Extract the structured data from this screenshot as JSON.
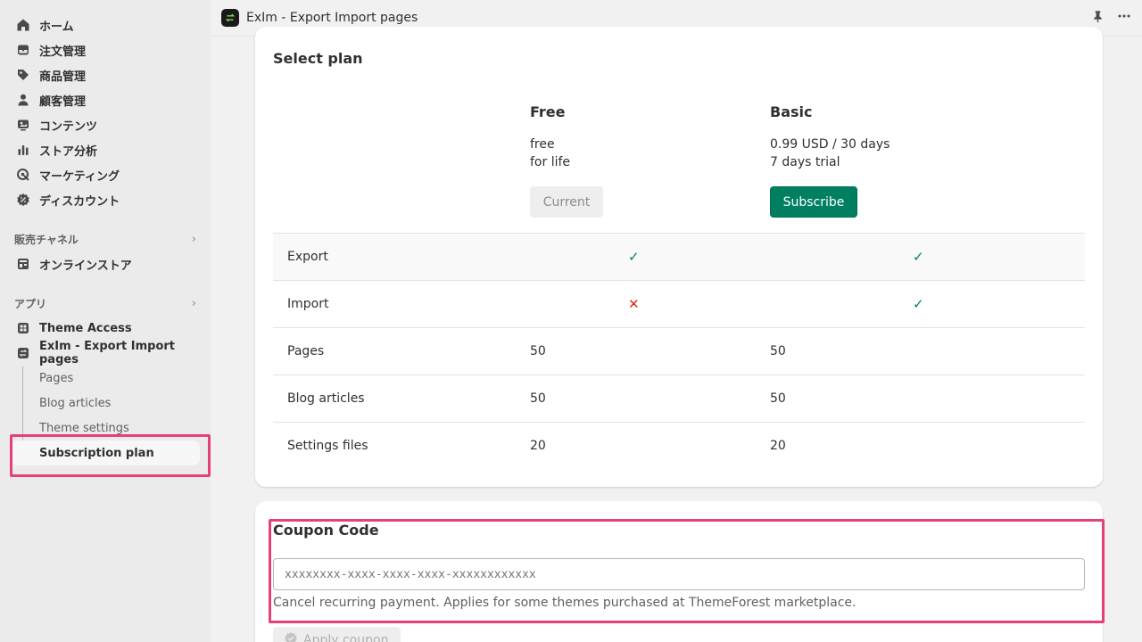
{
  "sidebar": {
    "nav": [
      {
        "label": "ホーム",
        "icon": "home-icon"
      },
      {
        "label": "注文管理",
        "icon": "inbox-icon"
      },
      {
        "label": "商品管理",
        "icon": "tag-icon"
      },
      {
        "label": "顧客管理",
        "icon": "person-icon"
      },
      {
        "label": "コンテンツ",
        "icon": "image-icon"
      },
      {
        "label": "ストア分析",
        "icon": "bar-chart-icon"
      },
      {
        "label": "マーケティング",
        "icon": "target-icon"
      },
      {
        "label": "ディスカウント",
        "icon": "discount-icon"
      }
    ],
    "sales_channels": {
      "title": "販売チャネル",
      "items": [
        {
          "label": "オンラインストア",
          "icon": "store-icon"
        }
      ]
    },
    "apps": {
      "title": "アプリ",
      "items": [
        {
          "label": "Theme Access",
          "icon": "app-icon"
        },
        {
          "label": "ExIm - Export Import pages",
          "icon": "exim-app-icon"
        }
      ],
      "subitems": [
        "Pages",
        "Blog articles",
        "Theme settings",
        "Subscription plan"
      ]
    }
  },
  "topbar": {
    "title": "ExIm - Export Import pages"
  },
  "plan_card": {
    "title": "Select plan",
    "plans": [
      {
        "name": "Free",
        "line1": "free",
        "line2": "for life",
        "button": "Current"
      },
      {
        "name": "Basic",
        "line1": "0.99 USD / 30 days",
        "line2": "7 days trial",
        "button": "Subscribe"
      }
    ],
    "features": [
      {
        "name": "Export",
        "free": "✓",
        "basic": "✓"
      },
      {
        "name": "Import",
        "free": "✕",
        "basic": "✓"
      },
      {
        "name": "Pages",
        "free": "50",
        "basic": "50"
      },
      {
        "name": "Blog articles",
        "free": "50",
        "basic": "50"
      },
      {
        "name": "Settings files",
        "free": "20",
        "basic": "20"
      }
    ]
  },
  "coupon_card": {
    "title": "Coupon Code",
    "placeholder": "xxxxxxxx-xxxx-xxxx-xxxx-xxxxxxxxxxxx",
    "help": "Cancel recurring payment. Applies for some themes purchased at ThemeForest marketplace.",
    "apply_label": "Apply coupon"
  },
  "colors": {
    "accent": "#008060",
    "highlight": "#e5407a",
    "error": "#d72c0d"
  }
}
